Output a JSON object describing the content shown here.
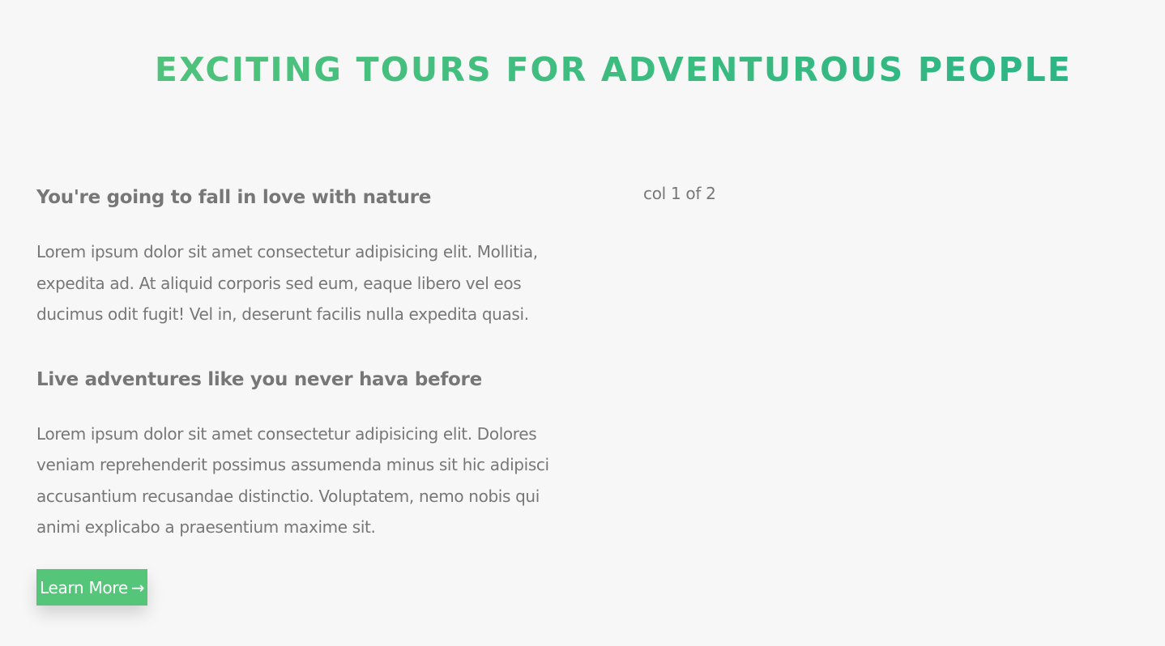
{
  "section": {
    "title": "EXCITING TOURS FOR ADVENTUROUS PEOPLE"
  },
  "about": {
    "heading_1": "You're going to fall in love with nature",
    "paragraph_1": "Lorem ipsum dolor sit amet consectetur adipisicing elit. Mollitia, expedita ad. At aliquid corporis sed eum, eaque libero vel eos ducimus odit fugit! Vel in, deserunt facilis nulla expedita quasi.",
    "heading_2": "Live adventures like you never hava before",
    "paragraph_2": "Lorem ipsum dolor sit amet consectetur adipisicing elit. Dolores veniam reprehenderit possimus assumenda minus sit hic adipisci accusantium recusandae distinctio. Voluptatem, nemo nobis qui animi explicabo a praesentium maxime sit.",
    "button_label": "Learn More",
    "button_arrow": "→",
    "right_column_text": "col 1 of 2"
  },
  "colors": {
    "accent": "#55c57a",
    "accent_dark": "#28b485",
    "text": "#777777",
    "background": "#f7f7f7"
  },
  "icons": {
    "button_icon": "arrow-right-icon"
  }
}
